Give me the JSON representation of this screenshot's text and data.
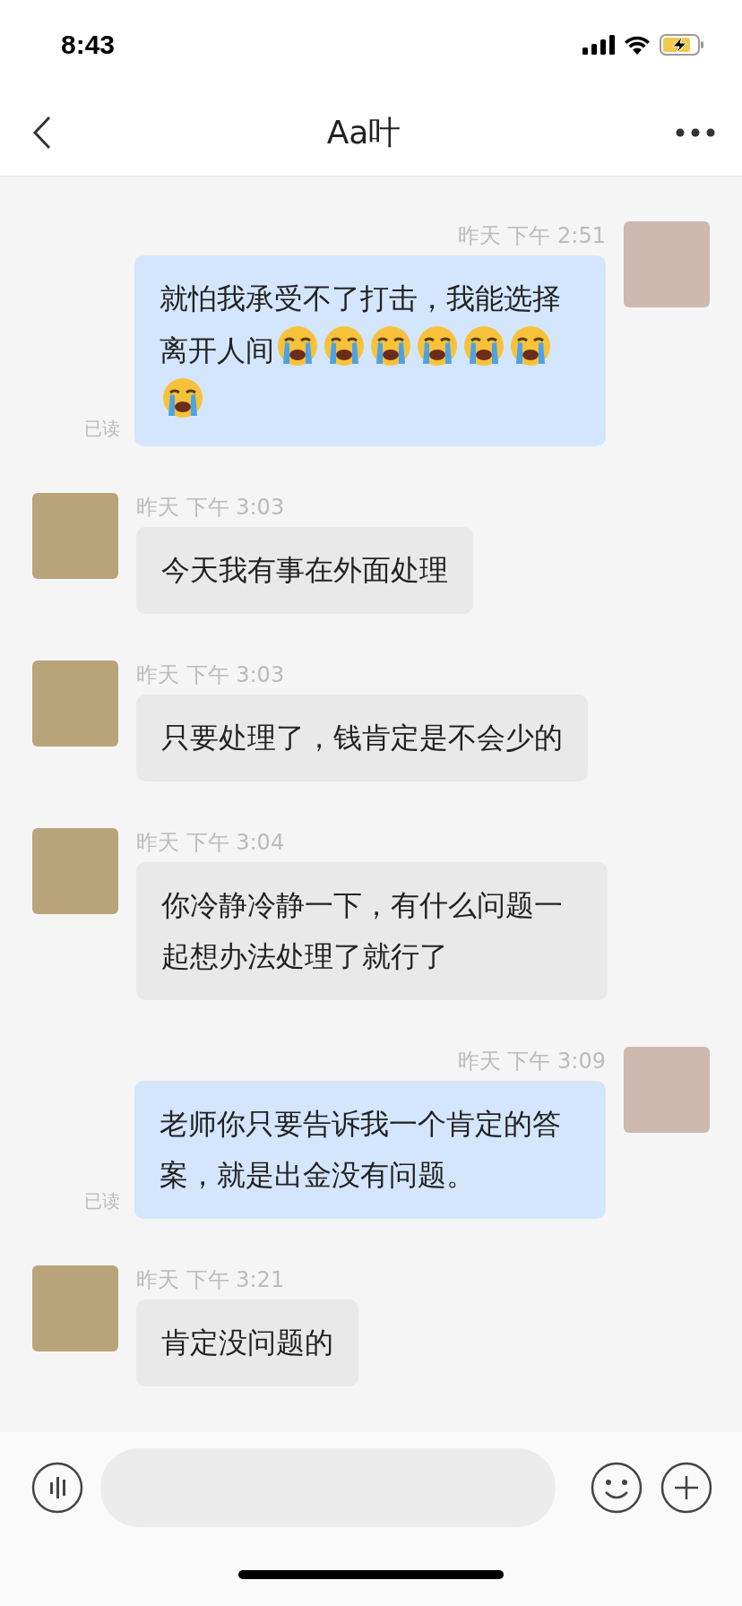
{
  "status_bar": {
    "time": "8:43"
  },
  "nav": {
    "title": "Aa叶"
  },
  "messages": [
    {
      "kind": "sent",
      "time": "昨天 下午 2:51",
      "text": "就怕我承受不了打击，我能选择离开人间",
      "emojis": [
        {
          "kind": "crying"
        },
        {
          "kind": "crying"
        },
        {
          "kind": "crying"
        },
        {
          "kind": "crying"
        },
        {
          "kind": "crying"
        },
        {
          "kind": "crying"
        },
        {
          "kind": "crying"
        }
      ],
      "status": "已读"
    },
    {
      "kind": "received",
      "time": "昨天 下午 3:03",
      "text": "今天我有事在外面处理"
    },
    {
      "kind": "received",
      "time": "昨天 下午 3:03",
      "text": "只要处理了，钱肯定是不会少的"
    },
    {
      "kind": "received",
      "time": "昨天 下午 3:04",
      "text": "你冷静冷静一下，有什么问题一起想办法处理了就行了"
    },
    {
      "kind": "sent",
      "time": "昨天 下午 3:09",
      "text": "老师你只要告诉我一个肯定的答案，就是出金没有问题。",
      "status": "已读"
    },
    {
      "kind": "received",
      "time": "昨天 下午 3:21",
      "text": "肯定没问题的"
    }
  ]
}
